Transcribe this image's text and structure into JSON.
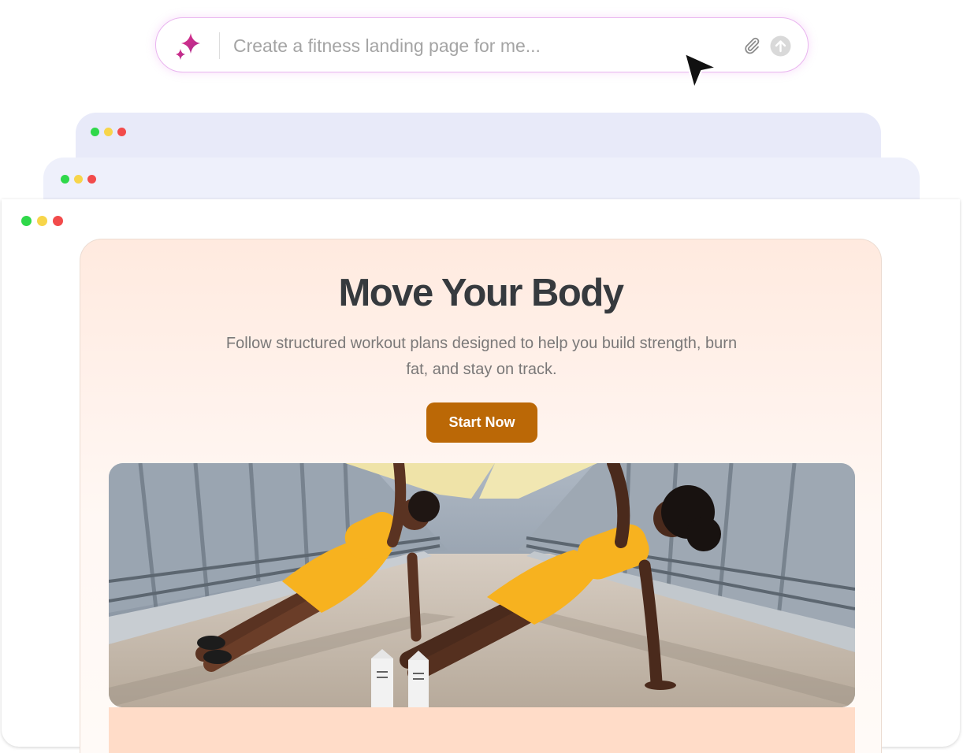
{
  "prompt": {
    "placeholder": "Create a fitness landing page for me...",
    "icons": [
      "sparkle-icon",
      "paperclip-icon",
      "send-icon"
    ],
    "accent_color": "#e9b5ef"
  },
  "cursor": {
    "icon": "pointer-cursor-icon"
  },
  "window_controls": {
    "colors": {
      "green": "#2fd84a",
      "yellow": "#f7d54a",
      "red": "#f24b4b"
    }
  },
  "landing": {
    "title": "Move Your Body",
    "subtitle": "Follow structured workout plans designed to help you build strength, burn fat, and stay on track.",
    "cta_label": "Start Now",
    "cta_color": "#bb6806",
    "background_color": "#ffeadf",
    "hero_image": {
      "description_icon": "fitness-photo",
      "accent_color": "#f7b52a"
    }
  }
}
